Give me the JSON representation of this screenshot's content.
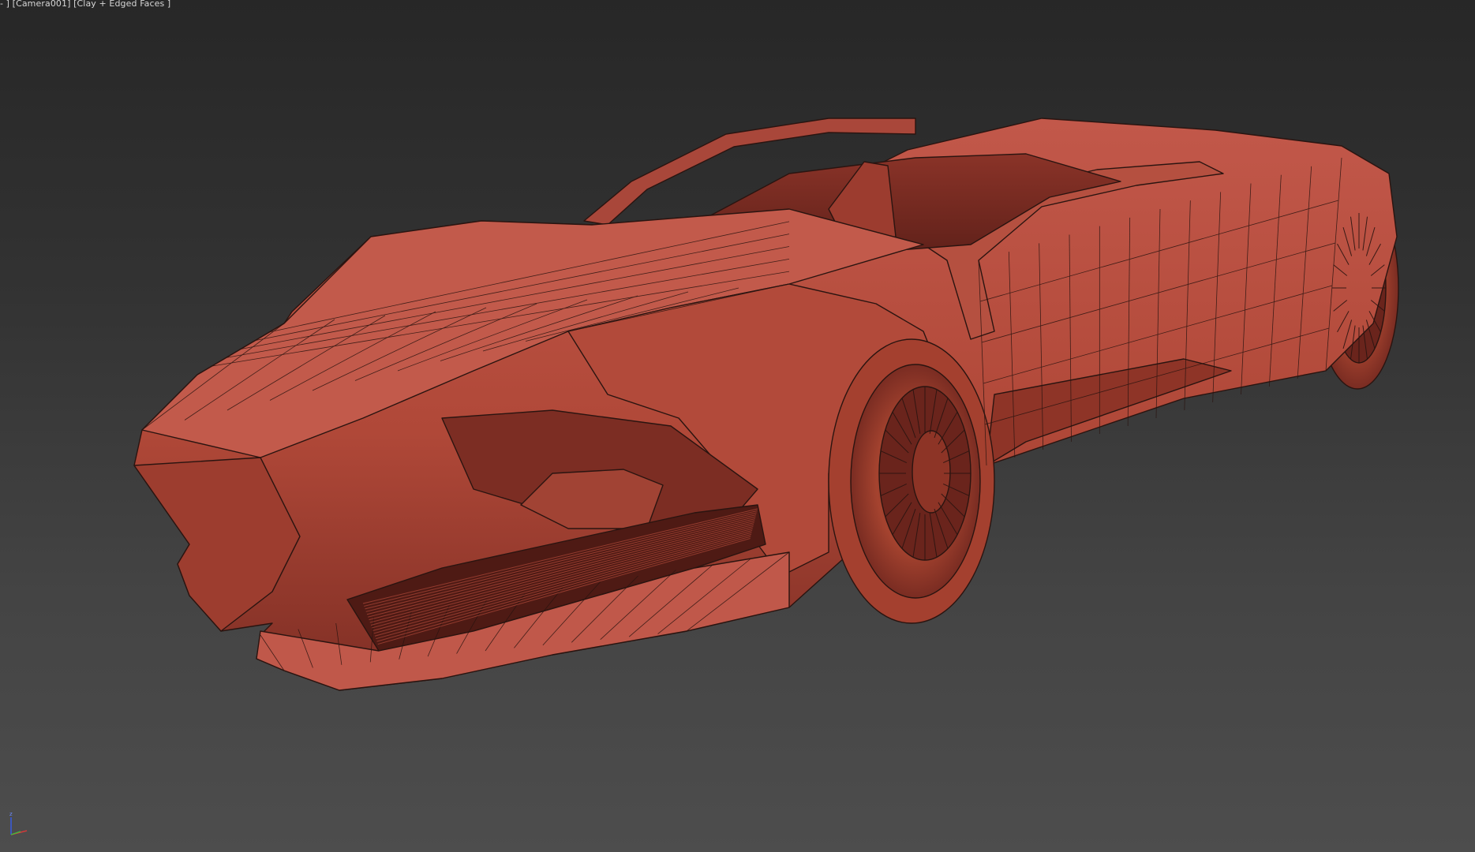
{
  "viewport": {
    "menu_label": "-",
    "camera_label": "Camera001",
    "shading_label": "Clay + Edged Faces"
  },
  "gizmo": {
    "axes": [
      "z",
      "x",
      "y"
    ],
    "colors": {
      "x": "#d23a3a",
      "y": "#3ac23a",
      "z": "#3a5ad8"
    }
  },
  "scene": {
    "object": "car-model",
    "clay_color": "#b24a3a",
    "edge_color": "#2a1410"
  }
}
